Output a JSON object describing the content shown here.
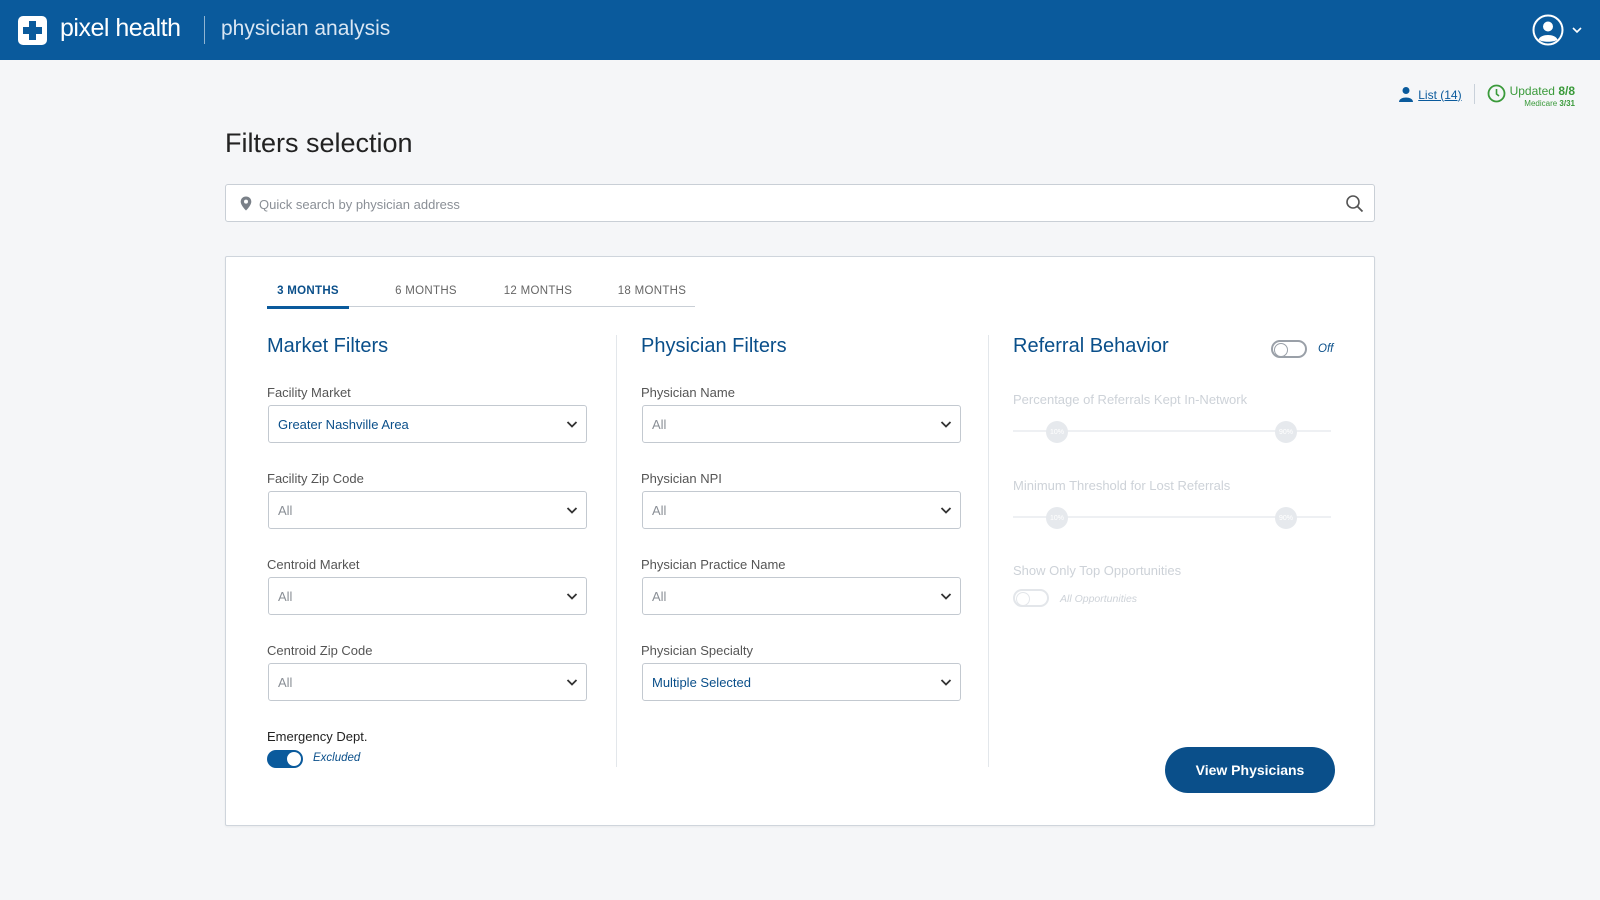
{
  "header": {
    "brand": "pixel health",
    "app_name": "physician analysis"
  },
  "status": {
    "list_label": "List (14)",
    "updated_prefix": "Updated",
    "updated_value": "8/8",
    "medicare_prefix": "Medicare",
    "medicare_value": "3/31"
  },
  "page": {
    "title": "Filters selection"
  },
  "search": {
    "placeholder": "Quick search by physician address"
  },
  "tabs": [
    {
      "label": "3 MONTHS"
    },
    {
      "label": "6 MONTHS"
    },
    {
      "label": "12 MONTHS"
    },
    {
      "label": "18 MONTHS"
    }
  ],
  "market": {
    "title": "Market Filters",
    "fields": [
      {
        "label": "Facility Market",
        "value": "Greater Nashville Area"
      },
      {
        "label": "Facility Zip Code",
        "value": "All"
      },
      {
        "label": "Centroid Market",
        "value": "All"
      },
      {
        "label": "Centroid Zip Code",
        "value": "All"
      }
    ],
    "emergency_label": "Emergency Dept.",
    "emergency_state": "Excluded"
  },
  "physician": {
    "title": "Physician Filters",
    "fields": [
      {
        "label": "Physician Name",
        "value": "All"
      },
      {
        "label": "Physician NPI",
        "value": "All"
      },
      {
        "label": "Physician Practice Name",
        "value": "All"
      },
      {
        "label": "Physician Specialty",
        "value": "Multiple Selected"
      }
    ]
  },
  "referral": {
    "title": "Referral Behavior",
    "toggle_state": "Off",
    "slider1_label": "Percentage of Referrals Kept In-Network",
    "slider1_min": "10%",
    "slider1_max": "90%",
    "slider2_label": "Minimum Threshold for Lost Referrals",
    "slider2_min": "10%",
    "slider2_max": "90%",
    "top_label": "Show Only Top Opportunities",
    "top_state": "All Opportunities"
  },
  "actions": {
    "view_label": "View Physicians"
  },
  "colors": {
    "brand_blue": "#0a5a9c",
    "accent_green": "#3a9a3a"
  }
}
